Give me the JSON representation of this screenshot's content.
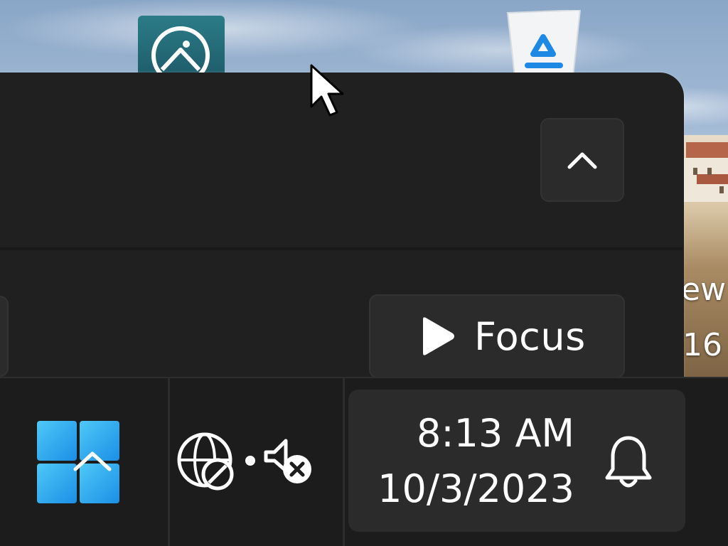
{
  "desktop": {
    "icons": [
      {
        "name": "Photos"
      },
      {
        "name": "Recycle Bin"
      }
    ],
    "wallpaper_text": [
      "ew",
      "16"
    ]
  },
  "flyout": {
    "collapse_icon": "chevron-up-icon",
    "focus_button": {
      "icon": "play-icon",
      "label": "Focus"
    }
  },
  "taskbar": {
    "start_icon": "windows-start-icon",
    "tray": {
      "network_icon": "globe-no-internet-icon",
      "volume_icon": "speaker-muted-icon"
    },
    "clock": {
      "time": "8:13 AM",
      "date": "10/3/2023"
    },
    "notifications_icon": "bell-icon"
  },
  "colors": {
    "taskbar_bg": "#1c1c1c",
    "flyout_bg": "#202020",
    "button_bg": "#2b2b2b",
    "start_blue": "#2aa6f0",
    "text": "#ffffff"
  }
}
